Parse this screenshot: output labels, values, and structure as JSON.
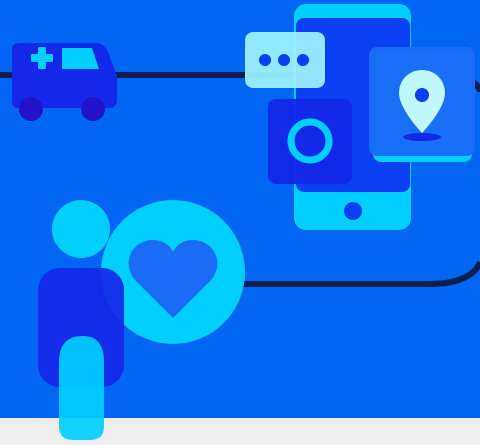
{
  "illustration": {
    "alt": "",
    "colors": {
      "background_blue": "#0065f3",
      "footer_gray": "#ededed",
      "dark_line": "#0e1f4f",
      "royal_blue": "#0a3ff2",
      "cyan": "#00cfff",
      "pale_cyan": "#9ef3ff",
      "deep_blue": "#1328e8"
    },
    "icons": [
      "ambulance-icon",
      "smartphone-icon",
      "chat-bubble-icon",
      "location-pin-icon",
      "circle-ring-icon",
      "person-icon",
      "heart-icon"
    ]
  }
}
